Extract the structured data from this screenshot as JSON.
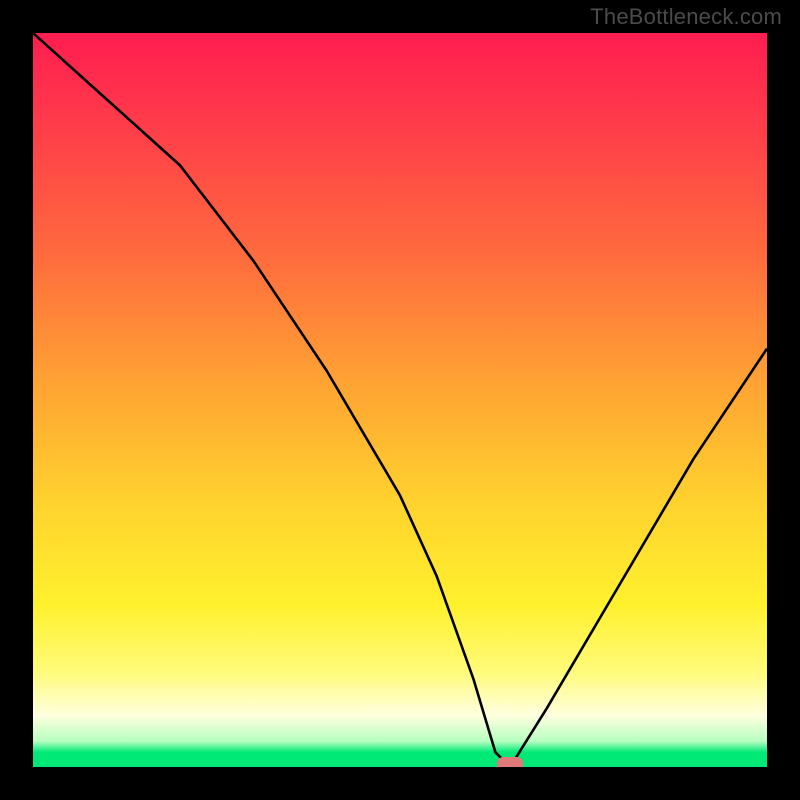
{
  "watermark": "TheBottleneck.com",
  "chart_data": {
    "type": "line",
    "title": "",
    "xlabel": "",
    "ylabel": "",
    "xlim": [
      0,
      100
    ],
    "ylim": [
      0,
      100
    ],
    "x": [
      0,
      10,
      20,
      30,
      40,
      50,
      55,
      60,
      63,
      65,
      70,
      80,
      90,
      100
    ],
    "values": [
      100,
      91,
      82,
      69,
      54,
      37,
      26,
      12,
      2,
      0,
      8,
      25,
      42,
      57
    ],
    "marker": {
      "x": 65,
      "y": 0,
      "color": "#e07a7a",
      "shape": "rounded-rect"
    }
  }
}
